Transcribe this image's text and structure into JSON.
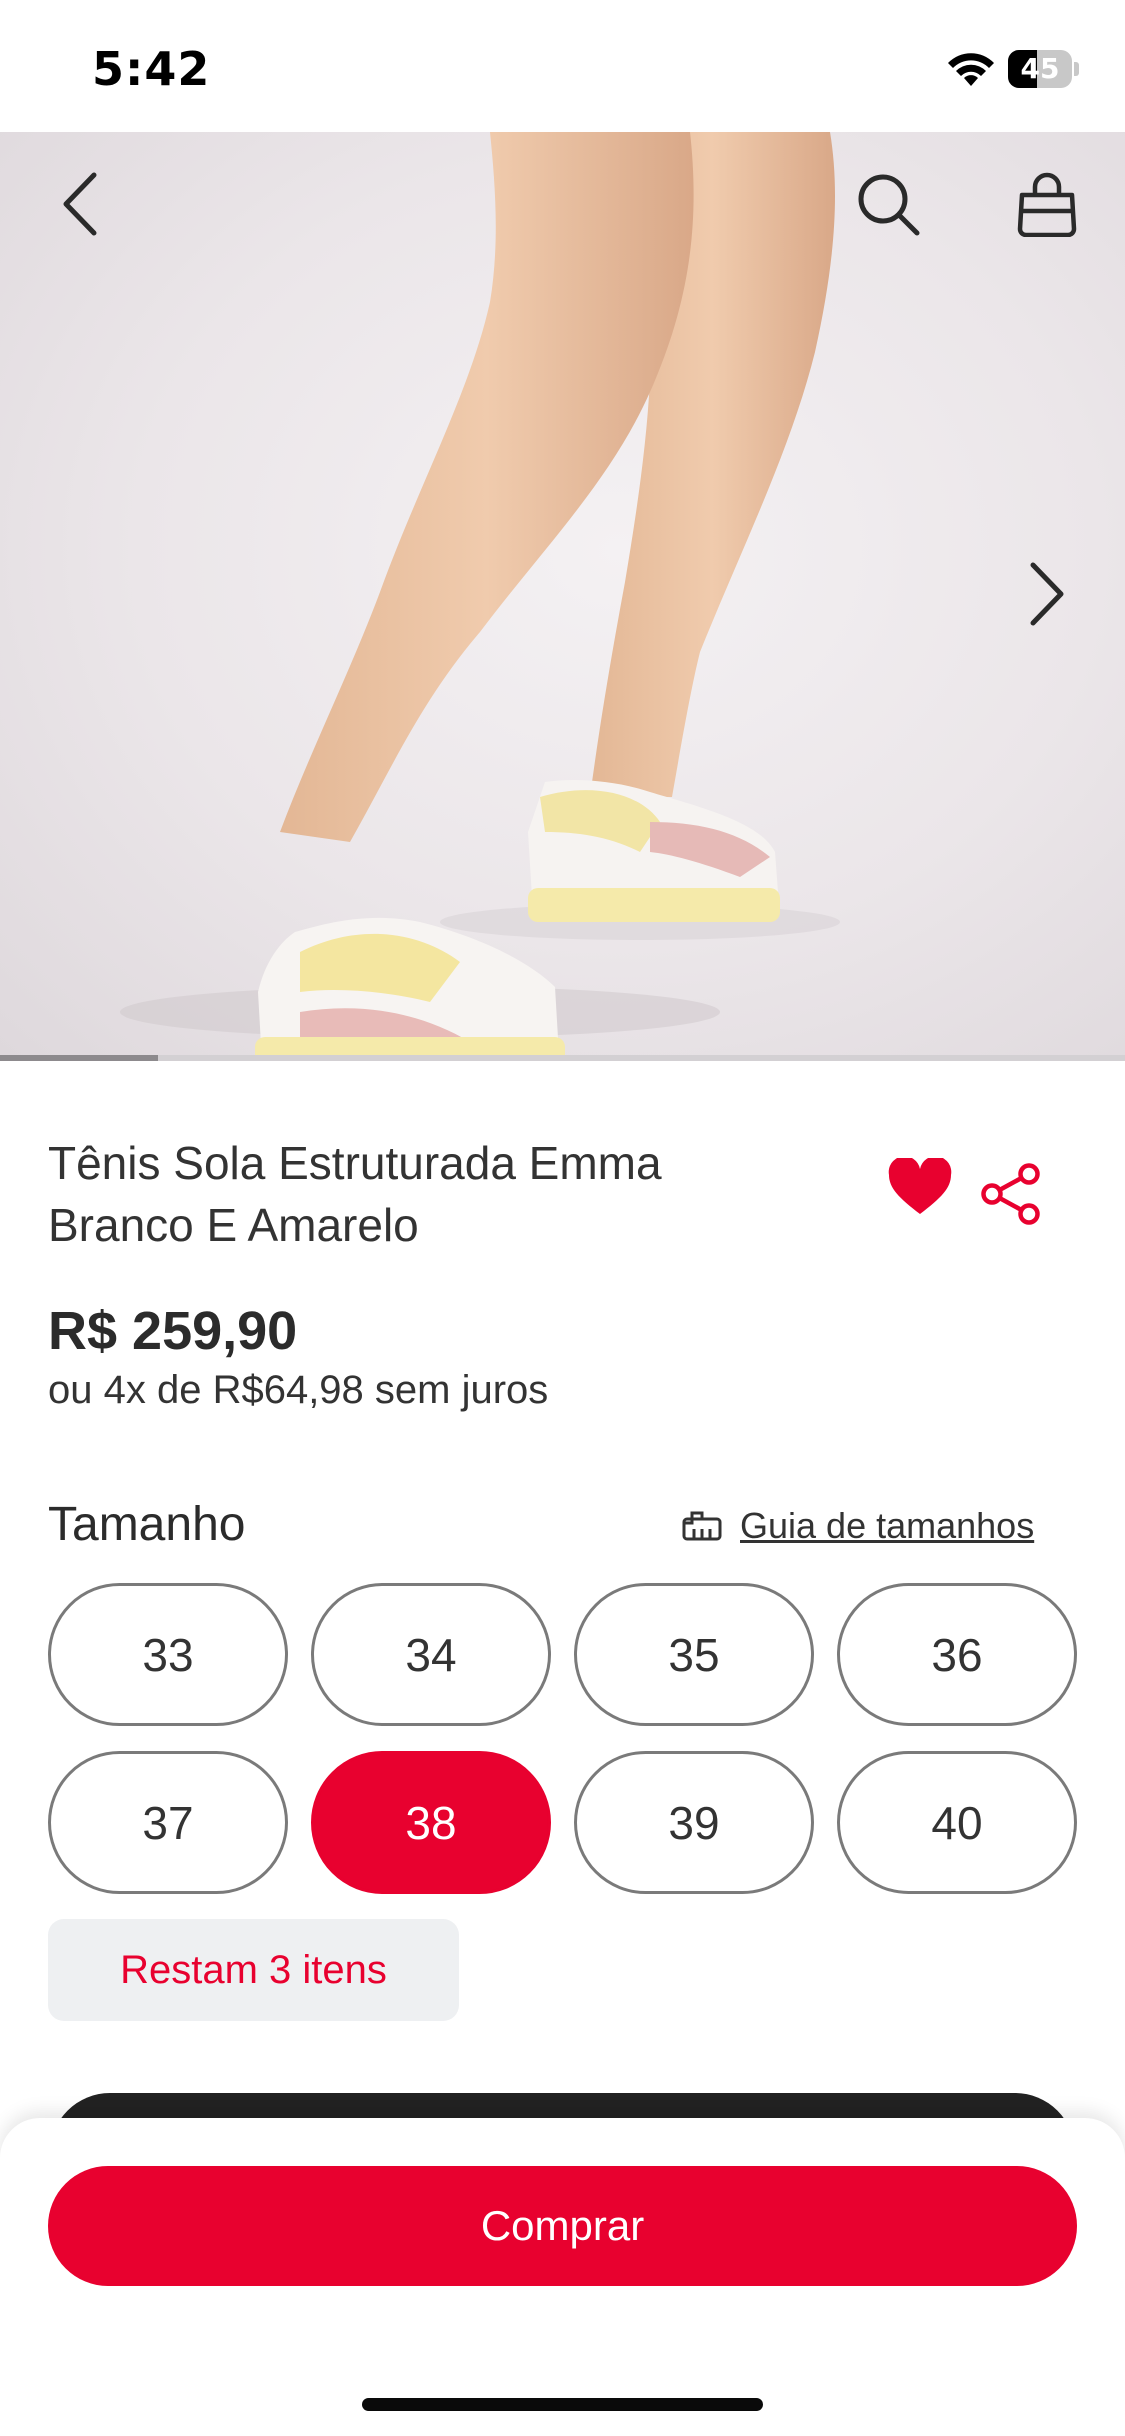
{
  "status_bar": {
    "time": "5:42",
    "battery_text": "45",
    "battery_level": 0.45
  },
  "hero": {
    "image_index": 1,
    "image_progress": 0.14,
    "icons": [
      "chevron-left-icon",
      "search-icon",
      "shopping-bag-icon",
      "chevron-right-icon"
    ]
  },
  "product": {
    "title_line1": "Tênis Sola Estruturada Emma",
    "title_line2": "Branco E Amarelo",
    "favorited": true,
    "price": "R$ 259,90",
    "installments": "ou 4x de R$64,98 sem juros"
  },
  "sizes": {
    "label": "Tamanho",
    "guide_link": "Guia de tamanhos",
    "options": [
      "33",
      "34",
      "35",
      "36",
      "37",
      "38",
      "39",
      "40"
    ],
    "selected": "38"
  },
  "stock": {
    "message": "Restam 3 itens"
  },
  "actions": {
    "buy_label": "Comprar"
  },
  "colors": {
    "accent": "#e8012f",
    "text": "#333333",
    "stock_bg": "#eef0f2"
  }
}
